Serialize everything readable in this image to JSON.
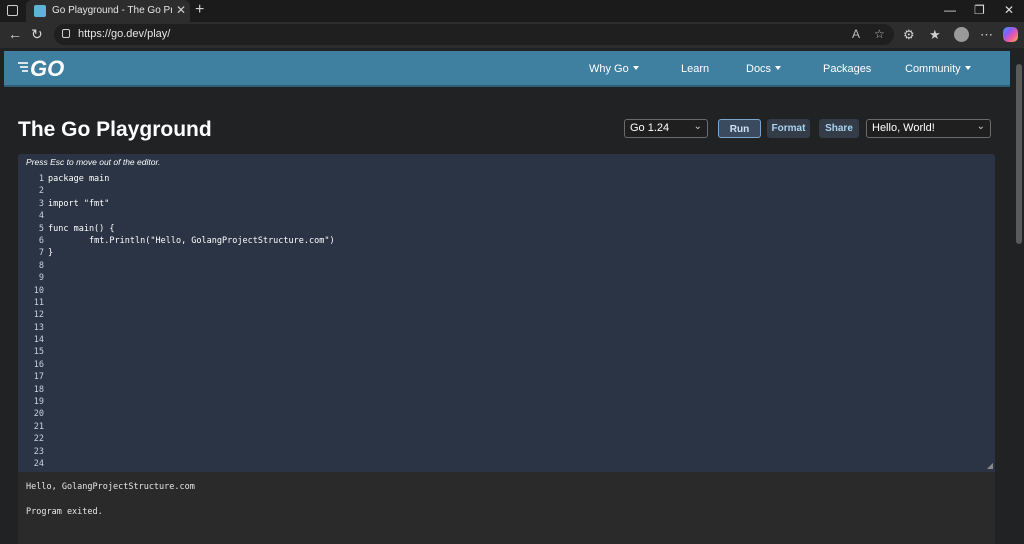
{
  "browser": {
    "tab_title": "Go Playground - The Go Programm",
    "url": "https://go.dev/play/"
  },
  "nav": {
    "items": [
      {
        "label": "Why Go",
        "dropdown": true
      },
      {
        "label": "Learn",
        "dropdown": false
      },
      {
        "label": "Docs",
        "dropdown": true
      },
      {
        "label": "Packages",
        "dropdown": false
      },
      {
        "label": "Community",
        "dropdown": true
      }
    ]
  },
  "playground": {
    "title": "The Go Playground",
    "version_select": "Go 1.24",
    "run_label": "Run",
    "format_label": "Format",
    "share_label": "Share",
    "example_select": "Hello, World!"
  },
  "editor": {
    "hint": "Press Esc to move out of the editor.",
    "line_numbers": [
      "1",
      "2",
      "3",
      "4",
      "5",
      "6",
      "7",
      "8",
      "9",
      "10",
      "11",
      "12",
      "13",
      "14",
      "15",
      "16",
      "17",
      "18",
      "19",
      "20",
      "21",
      "22",
      "23",
      "24"
    ],
    "code_lines": [
      "package main",
      "",
      "import \"fmt\"",
      "",
      "func main() {",
      "\tfmt.Println(\"Hello, GolangProjectStructure.com\")",
      "}"
    ]
  },
  "output": {
    "lines": [
      "Hello, GolangProjectStructure.com",
      "Program exited."
    ]
  },
  "colors": {
    "nav_bg": "#3f7f9f",
    "editor_bg": "#2a3444",
    "page_bg": "#202224"
  }
}
